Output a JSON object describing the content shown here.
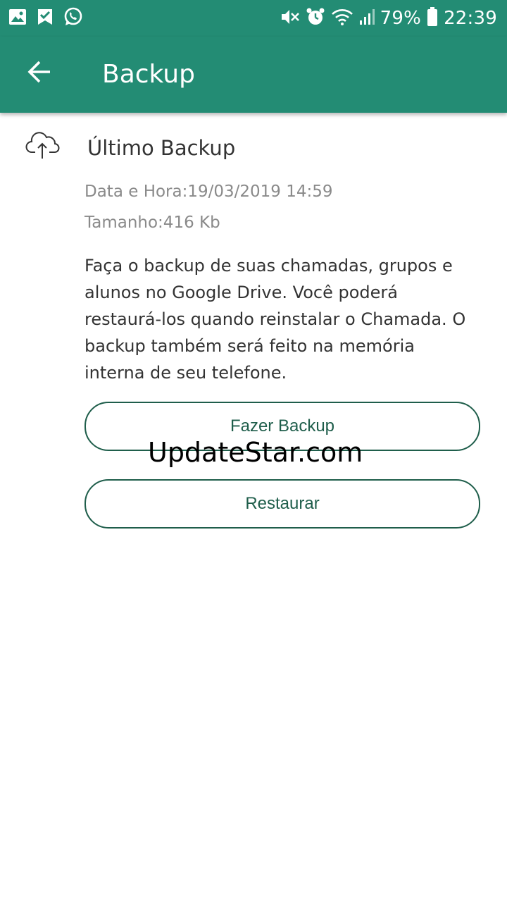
{
  "status_bar": {
    "battery_percent": "79%",
    "time": "22:39",
    "left_icons": [
      "gallery-icon",
      "check-badge-icon",
      "whatsapp-icon"
    ],
    "right_icons": [
      "mute-icon",
      "alarm-icon",
      "wifi-icon",
      "signal-icon",
      "battery-icon"
    ]
  },
  "app_bar": {
    "title": "Backup",
    "back_icon": "arrow-back-icon",
    "background_color": "#238c74"
  },
  "backup": {
    "icon": "cloud-upload-icon",
    "title": "Último Backup",
    "date_time": "Data e Hora:19/03/2019 14:59",
    "size": "Tamanho:416 Kb",
    "description": "Faça o backup de suas chamadas, grupos e alunos no Google Drive. Você poderá restaurá-los quando reinstalar o Chamada. O backup também será feito na memória interna de seu telefone."
  },
  "buttons": {
    "backup_label": "Fazer Backup",
    "restore_label": "Restaurar",
    "accent_color": "#1f5e4b"
  },
  "watermark": "UpdateStar.com"
}
